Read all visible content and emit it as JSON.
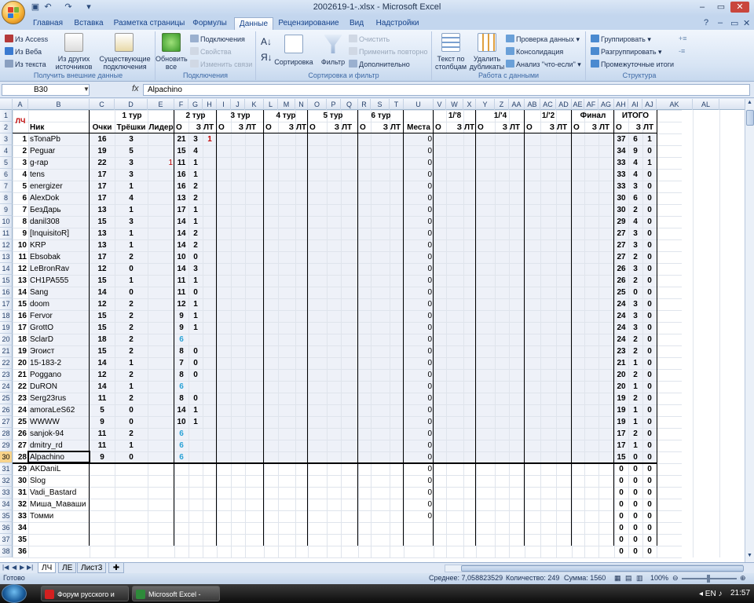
{
  "window": {
    "title": "2002619-1-.xlsx - Microsoft Excel"
  },
  "tabs": [
    "Главная",
    "Вставка",
    "Разметка страницы",
    "Формулы",
    "Данные",
    "Рецензирование",
    "Вид",
    "Надстройки"
  ],
  "ribbon": {
    "get_external": {
      "access": "Из Access",
      "web": "Из Веба",
      "text": "Из текста",
      "other": "Из других источников",
      "existing": "Существующие подключения",
      "label": "Получить внешние данные"
    },
    "connections": {
      "refresh": "Обновить все",
      "conn": "Подключения",
      "props": "Свойства",
      "edit": "Изменить связи",
      "label": "Подключения"
    },
    "sort": {
      "sort": "Сортировка",
      "filter": "Фильтр",
      "clear": "Очистить",
      "reapply": "Применить повторно",
      "advanced": "Дополнительно",
      "label": "Сортировка и фильтр"
    },
    "tools": {
      "text_cols": "Текст по столбцам",
      "remove_dup": "Удалить дубликаты",
      "validation": "Проверка данных",
      "consolidate": "Консолидация",
      "whatif": "Анализ \"что-если\"",
      "label": "Работа с данными"
    },
    "outline": {
      "group": "Группировать",
      "ungroup": "Разгруппировать",
      "subtotal": "Промежуточные итоги",
      "label": "Структура"
    }
  },
  "formula_bar": {
    "name_box": "B30",
    "fx": "fx",
    "value": "Alpachino"
  },
  "columns": [
    "A",
    "B",
    "C",
    "D",
    "E",
    "F",
    "G",
    "H",
    "I",
    "J",
    "K",
    "L",
    "M",
    "N",
    "O",
    "P",
    "Q",
    "R",
    "S",
    "T",
    "U",
    "V",
    "W",
    "X",
    "Y",
    "Z",
    "AA",
    "AB",
    "AC",
    "AD",
    "AE",
    "AF",
    "AG",
    "AH",
    "AI",
    "AJ",
    "AK",
    "AL"
  ],
  "header1": {
    "lch": "ЛЧ",
    "tour1": "1 тур",
    "tour2": "2 тур",
    "tour3": "3 тур",
    "tour4": "4 тур",
    "tour5": "5 тур",
    "tour6": "6 тур",
    "r8": "1/'8",
    "r4": "1/'4",
    "r2": "1/'2",
    "final": "Финал",
    "total": "ИТОГО"
  },
  "header2": {
    "nick": "Ник",
    "points": "Очки",
    "threes": "Трёшки",
    "leader": "Лидер",
    "o": "О",
    "z": "З",
    "lt": "ЛТ",
    "places": "Места"
  },
  "rows": [
    {
      "r": "3",
      "n": "1",
      "nick": "sTonaPb",
      "p": "16",
      "t": "3",
      "l": "",
      "o2": "21",
      "z2": "3",
      "lt2": "1",
      "m": "0",
      "to": "37",
      "tz": "6",
      "tl": "1"
    },
    {
      "r": "4",
      "n": "2",
      "nick": "Peguar",
      "p": "19",
      "t": "5",
      "l": "",
      "o2": "15",
      "z2": "4",
      "lt2": "",
      "m": "0",
      "to": "34",
      "tz": "9",
      "tl": "0"
    },
    {
      "r": "5",
      "n": "3",
      "nick": "g-rap",
      "p": "22",
      "t": "3",
      "l": "1",
      "o2": "11",
      "z2": "1",
      "lt2": "",
      "m": "0",
      "to": "33",
      "tz": "4",
      "tl": "1"
    },
    {
      "r": "6",
      "n": "4",
      "nick": "tens",
      "p": "17",
      "t": "3",
      "l": "",
      "o2": "16",
      "z2": "1",
      "lt2": "",
      "m": "0",
      "to": "33",
      "tz": "4",
      "tl": "0"
    },
    {
      "r": "7",
      "n": "5",
      "nick": "energizer",
      "p": "17",
      "t": "1",
      "l": "",
      "o2": "16",
      "z2": "2",
      "lt2": "",
      "m": "0",
      "to": "33",
      "tz": "3",
      "tl": "0"
    },
    {
      "r": "8",
      "n": "6",
      "nick": "AlexDok",
      "p": "17",
      "t": "4",
      "l": "",
      "o2": "13",
      "z2": "2",
      "lt2": "",
      "m": "0",
      "to": "30",
      "tz": "6",
      "tl": "0"
    },
    {
      "r": "9",
      "n": "7",
      "nick": "БезДарь",
      "p": "13",
      "t": "1",
      "l": "",
      "o2": "17",
      "z2": "1",
      "lt2": "",
      "m": "0",
      "to": "30",
      "tz": "2",
      "tl": "0"
    },
    {
      "r": "10",
      "n": "8",
      "nick": "danil308",
      "p": "15",
      "t": "3",
      "l": "",
      "o2": "14",
      "z2": "1",
      "lt2": "",
      "m": "0",
      "to": "29",
      "tz": "4",
      "tl": "0"
    },
    {
      "r": "11",
      "n": "9",
      "nick": "[InquisitoR]",
      "p": "13",
      "t": "1",
      "l": "",
      "o2": "14",
      "z2": "2",
      "lt2": "",
      "m": "0",
      "to": "27",
      "tz": "3",
      "tl": "0"
    },
    {
      "r": "12",
      "n": "10",
      "nick": "KRP",
      "p": "13",
      "t": "1",
      "l": "",
      "o2": "14",
      "z2": "2",
      "lt2": "",
      "m": "0",
      "to": "27",
      "tz": "3",
      "tl": "0"
    },
    {
      "r": "13",
      "n": "11",
      "nick": "Ebsobak",
      "p": "17",
      "t": "2",
      "l": "",
      "o2": "10",
      "z2": "0",
      "lt2": "",
      "m": "0",
      "to": "27",
      "tz": "2",
      "tl": "0"
    },
    {
      "r": "14",
      "n": "12",
      "nick": "LeBronRav",
      "p": "12",
      "t": "0",
      "l": "",
      "o2": "14",
      "z2": "3",
      "lt2": "",
      "m": "0",
      "to": "26",
      "tz": "3",
      "tl": "0"
    },
    {
      "r": "15",
      "n": "13",
      "nick": "CH1PA555",
      "p": "15",
      "t": "1",
      "l": "",
      "o2": "11",
      "z2": "1",
      "lt2": "",
      "m": "0",
      "to": "26",
      "tz": "2",
      "tl": "0"
    },
    {
      "r": "16",
      "n": "14",
      "nick": "Sang",
      "p": "14",
      "t": "0",
      "l": "",
      "o2": "11",
      "z2": "0",
      "lt2": "",
      "m": "0",
      "to": "25",
      "tz": "0",
      "tl": "0"
    },
    {
      "r": "17",
      "n": "15",
      "nick": "doom",
      "p": "12",
      "t": "2",
      "l": "",
      "o2": "12",
      "z2": "1",
      "lt2": "",
      "m": "0",
      "to": "24",
      "tz": "3",
      "tl": "0"
    },
    {
      "r": "18",
      "n": "16",
      "nick": "Fervor",
      "p": "15",
      "t": "2",
      "l": "",
      "o2": "9",
      "z2": "1",
      "lt2": "",
      "m": "0",
      "to": "24",
      "tz": "3",
      "tl": "0"
    },
    {
      "r": "19",
      "n": "17",
      "nick": "GrottO",
      "p": "15",
      "t": "2",
      "l": "",
      "o2": "9",
      "z2": "1",
      "lt2": "",
      "m": "0",
      "to": "24",
      "tz": "3",
      "tl": "0"
    },
    {
      "r": "20",
      "n": "18",
      "nick": "SclarD",
      "p": "18",
      "t": "2",
      "l": "",
      "o2": "6",
      "z2": "",
      "lt2": "",
      "m": "0",
      "to": "24",
      "tz": "2",
      "tl": "0",
      "teal": true
    },
    {
      "r": "21",
      "n": "19",
      "nick": "Эгоист",
      "p": "15",
      "t": "2",
      "l": "",
      "o2": "8",
      "z2": "0",
      "lt2": "",
      "m": "0",
      "to": "23",
      "tz": "2",
      "tl": "0"
    },
    {
      "r": "22",
      "n": "20",
      "nick": "15-183-2",
      "p": "14",
      "t": "1",
      "l": "",
      "o2": "7",
      "z2": "0",
      "lt2": "",
      "m": "0",
      "to": "21",
      "tz": "1",
      "tl": "0"
    },
    {
      "r": "23",
      "n": "21",
      "nick": "Poggano",
      "p": "12",
      "t": "2",
      "l": "",
      "o2": "8",
      "z2": "0",
      "lt2": "",
      "m": "0",
      "to": "20",
      "tz": "2",
      "tl": "0"
    },
    {
      "r": "24",
      "n": "22",
      "nick": "DuRON",
      "p": "14",
      "t": "1",
      "l": "",
      "o2": "6",
      "z2": "",
      "lt2": "",
      "m": "0",
      "to": "20",
      "tz": "1",
      "tl": "0",
      "teal": true
    },
    {
      "r": "25",
      "n": "23",
      "nick": "Serg23rus",
      "p": "11",
      "t": "2",
      "l": "",
      "o2": "8",
      "z2": "0",
      "lt2": "",
      "m": "0",
      "to": "19",
      "tz": "2",
      "tl": "0"
    },
    {
      "r": "26",
      "n": "24",
      "nick": "amoraLeS62",
      "p": "5",
      "t": "0",
      "l": "",
      "o2": "14",
      "z2": "1",
      "lt2": "",
      "m": "0",
      "to": "19",
      "tz": "1",
      "tl": "0"
    },
    {
      "r": "27",
      "n": "25",
      "nick": "WWWW",
      "p": "9",
      "t": "0",
      "l": "",
      "o2": "10",
      "z2": "1",
      "lt2": "",
      "m": "0",
      "to": "19",
      "tz": "1",
      "tl": "0"
    },
    {
      "r": "28",
      "n": "26",
      "nick": "sanjok-94",
      "p": "11",
      "t": "2",
      "l": "",
      "o2": "6",
      "z2": "",
      "lt2": "",
      "m": "0",
      "to": "17",
      "tz": "2",
      "tl": "0",
      "teal": true
    },
    {
      "r": "29",
      "n": "27",
      "nick": "dmitry_rd",
      "p": "11",
      "t": "1",
      "l": "",
      "o2": "6",
      "z2": "",
      "lt2": "",
      "m": "0",
      "to": "17",
      "tz": "1",
      "tl": "0",
      "teal": true
    },
    {
      "r": "30",
      "n": "28",
      "nick": "Alpachino",
      "p": "9",
      "t": "0",
      "l": "",
      "o2": "6",
      "z2": "",
      "lt2": "",
      "m": "0",
      "to": "15",
      "tz": "0",
      "tl": "0",
      "teal": true
    },
    {
      "r": "31",
      "n": "29",
      "nick": "AKDaniL",
      "p": "",
      "t": "",
      "l": "",
      "o2": "",
      "z2": "",
      "lt2": "",
      "m": "0",
      "to": "0",
      "tz": "0",
      "tl": "0"
    },
    {
      "r": "32",
      "n": "30",
      "nick": "Slog",
      "p": "",
      "t": "",
      "l": "",
      "o2": "",
      "z2": "",
      "lt2": "",
      "m": "0",
      "to": "0",
      "tz": "0",
      "tl": "0"
    },
    {
      "r": "33",
      "n": "31",
      "nick": "Vadi_Bastard",
      "p": "",
      "t": "",
      "l": "",
      "o2": "",
      "z2": "",
      "lt2": "",
      "m": "0",
      "to": "0",
      "tz": "0",
      "tl": "0"
    },
    {
      "r": "34",
      "n": "32",
      "nick": "Миша_Маваши",
      "p": "",
      "t": "",
      "l": "",
      "o2": "",
      "z2": "",
      "lt2": "",
      "m": "0",
      "to": "0",
      "tz": "0",
      "tl": "0"
    },
    {
      "r": "35",
      "n": "33",
      "nick": "Томми",
      "p": "",
      "t": "",
      "l": "",
      "o2": "",
      "z2": "",
      "lt2": "",
      "m": "0",
      "to": "0",
      "tz": "0",
      "tl": "0"
    },
    {
      "r": "36",
      "n": "34",
      "nick": "",
      "p": "",
      "t": "",
      "l": "",
      "o2": "",
      "z2": "",
      "lt2": "",
      "m": "",
      "to": "0",
      "tz": "0",
      "tl": "0"
    },
    {
      "r": "37",
      "n": "35",
      "nick": "",
      "p": "",
      "t": "",
      "l": "",
      "o2": "",
      "z2": "",
      "lt2": "",
      "m": "",
      "to": "0",
      "tz": "0",
      "tl": "0"
    },
    {
      "r": "38",
      "n": "36",
      "nick": "",
      "p": "",
      "t": "",
      "l": "",
      "o2": "",
      "z2": "",
      "lt2": "",
      "m": "",
      "to": "0",
      "tz": "0",
      "tl": "0"
    }
  ],
  "sheets": [
    "ЛЧ",
    "ЛЕ",
    "Лист3"
  ],
  "status": {
    "ready": "Готово",
    "avg": "Среднее: 7,058823529",
    "count": "Количество: 249",
    "sum": "Сумма: 1560",
    "zoom": "100%"
  },
  "taskbar": {
    "t1": "Форум русского и за...",
    "t2": "Microsoft Excel - 200...",
    "clock": "21:57"
  }
}
